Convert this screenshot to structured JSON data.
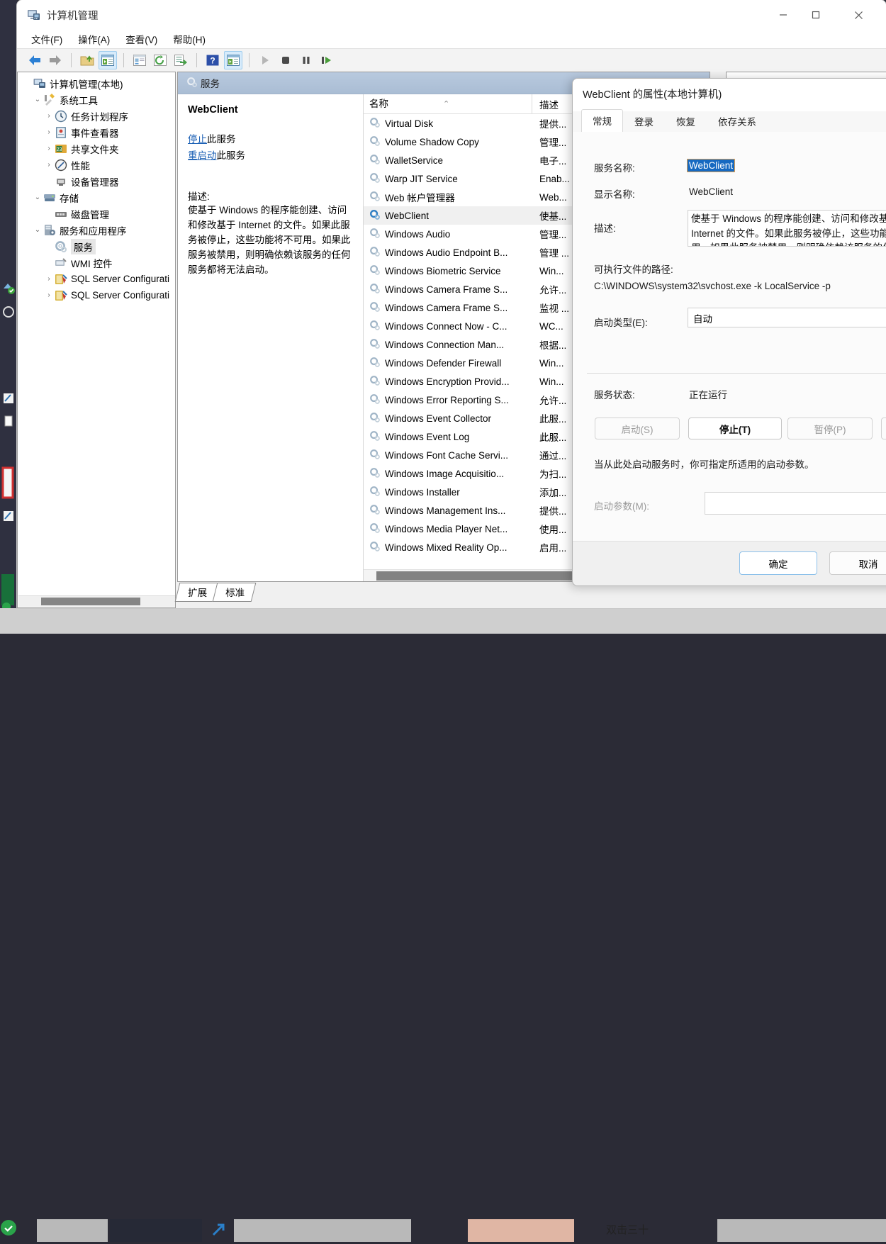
{
  "window": {
    "title": "计算机管理",
    "icon": "computer-management-icon",
    "controls": {
      "minimize": "—",
      "maximize": "□",
      "close": "✕"
    }
  },
  "menubar": [
    {
      "label": "文件(F)",
      "name": "menu-file"
    },
    {
      "label": "操作(A)",
      "name": "menu-action"
    },
    {
      "label": "查看(V)",
      "name": "menu-view"
    },
    {
      "label": "帮助(H)",
      "name": "menu-help"
    }
  ],
  "toolbar": [
    {
      "name": "back-icon",
      "glyph": "⬅",
      "selected": false
    },
    {
      "name": "forward-icon",
      "glyph": "➡",
      "selected": false
    },
    {
      "sep": true
    },
    {
      "name": "up-folder-icon",
      "glyph": "📁",
      "selected": false
    },
    {
      "name": "show-hide-console-tree-icon",
      "glyph": "▤",
      "selected": true
    },
    {
      "sep": true
    },
    {
      "name": "properties-icon",
      "glyph": "▤",
      "selected": false
    },
    {
      "name": "refresh-icon",
      "glyph": "↻",
      "selected": false
    },
    {
      "name": "export-list-icon",
      "glyph": "⇥",
      "selected": false
    },
    {
      "sep": true
    },
    {
      "name": "help-icon",
      "glyph": "?",
      "selected": false
    },
    {
      "name": "show-action-pane-icon",
      "glyph": "▤",
      "selected": true
    },
    {
      "sep": true
    },
    {
      "name": "start-service-icon",
      "glyph": "▶",
      "selected": false
    },
    {
      "name": "stop-service-icon",
      "glyph": "■",
      "selected": false
    },
    {
      "name": "pause-service-icon",
      "glyph": "❙❙",
      "selected": false
    },
    {
      "name": "restart-service-icon",
      "glyph": "❙▶",
      "selected": false
    }
  ],
  "tree": [
    {
      "label": "计算机管理(本地)",
      "indent": 0,
      "chevron": "",
      "icon": "computer-icon",
      "selected": false
    },
    {
      "label": "系统工具",
      "indent": 1,
      "chevron": "⌄",
      "icon": "system-tools-icon",
      "selected": false
    },
    {
      "label": "任务计划程序",
      "indent": 2,
      "chevron": "›",
      "icon": "task-scheduler-icon",
      "selected": false
    },
    {
      "label": "事件查看器",
      "indent": 2,
      "chevron": "›",
      "icon": "event-viewer-icon",
      "selected": false
    },
    {
      "label": "共享文件夹",
      "indent": 2,
      "chevron": "›",
      "icon": "shared-folders-icon",
      "selected": false
    },
    {
      "label": "性能",
      "indent": 2,
      "chevron": "›",
      "icon": "performance-icon",
      "selected": false
    },
    {
      "label": "设备管理器",
      "indent": 2,
      "chevron": "",
      "icon": "device-manager-icon",
      "selected": false
    },
    {
      "label": "存储",
      "indent": 1,
      "chevron": "⌄",
      "icon": "storage-icon",
      "selected": false
    },
    {
      "label": "磁盘管理",
      "indent": 2,
      "chevron": "",
      "icon": "disk-management-icon",
      "selected": false
    },
    {
      "label": "服务和应用程序",
      "indent": 1,
      "chevron": "⌄",
      "icon": "services-apps-icon",
      "selected": false
    },
    {
      "label": "服务",
      "indent": 2,
      "chevron": "",
      "icon": "services-icon",
      "selected": true
    },
    {
      "label": "WMI 控件",
      "indent": 2,
      "chevron": "",
      "icon": "wmi-control-icon",
      "selected": false
    },
    {
      "label": "SQL Server Configurati",
      "indent": 2,
      "chevron": "›",
      "icon": "sql-server-config-icon",
      "selected": false
    },
    {
      "label": "SQL Server Configurati",
      "indent": 2,
      "chevron": "›",
      "icon": "sql-server-config-icon",
      "selected": false
    }
  ],
  "services_view": {
    "header": "服务",
    "header_icon": "services-icon",
    "detail": {
      "title": "WebClient",
      "links": [
        {
          "action": "停止",
          "suffix": "此服务",
          "name": "stop-service-link"
        },
        {
          "action": "重启动",
          "suffix": "此服务",
          "name": "restart-service-link"
        }
      ],
      "description_label": "描述:",
      "description": "使基于 Windows 的程序能创建、访问和修改基于 Internet 的文件。如果此服务被停止，这些功能将不可用。如果此服务被禁用，则明确依赖该服务的任何服务都将无法启动。"
    },
    "columns": {
      "name": "名称",
      "description": "描述",
      "sort_indicator": "⌃"
    },
    "rows": [
      {
        "name": "Virtual Disk",
        "desc": "提供...",
        "selected": false
      },
      {
        "name": "Volume Shadow Copy",
        "desc": "管理...",
        "selected": false
      },
      {
        "name": "WalletService",
        "desc": "电子...",
        "selected": false
      },
      {
        "name": "Warp JIT Service",
        "desc": "Enab...",
        "selected": false
      },
      {
        "name": "Web 帐户管理器",
        "desc": "Web...",
        "selected": false
      },
      {
        "name": "WebClient",
        "desc": "使基...",
        "selected": true
      },
      {
        "name": "Windows Audio",
        "desc": "管理...",
        "selected": false
      },
      {
        "name": "Windows Audio Endpoint B...",
        "desc": "管理 ...",
        "selected": false
      },
      {
        "name": "Windows Biometric Service",
        "desc": "Win...",
        "selected": false
      },
      {
        "name": "Windows Camera Frame S...",
        "desc": "允许...",
        "selected": false
      },
      {
        "name": "Windows Camera Frame S...",
        "desc": "监视 ...",
        "selected": false
      },
      {
        "name": "Windows Connect Now - C...",
        "desc": "WC...",
        "selected": false
      },
      {
        "name": "Windows Connection Man...",
        "desc": "根据...",
        "selected": false
      },
      {
        "name": "Windows Defender Firewall",
        "desc": "Win...",
        "selected": false
      },
      {
        "name": "Windows Encryption Provid...",
        "desc": "Win...",
        "selected": false
      },
      {
        "name": "Windows Error Reporting S...",
        "desc": "允许...",
        "selected": false
      },
      {
        "name": "Windows Event Collector",
        "desc": "此服...",
        "selected": false
      },
      {
        "name": "Windows Event Log",
        "desc": "此服...",
        "selected": false
      },
      {
        "name": "Windows Font Cache Servi...",
        "desc": "通过...",
        "selected": false
      },
      {
        "name": "Windows Image Acquisitio...",
        "desc": "为扫...",
        "selected": false
      },
      {
        "name": "Windows Installer",
        "desc": "添加...",
        "selected": false
      },
      {
        "name": "Windows Management Ins...",
        "desc": "提供...",
        "selected": false
      },
      {
        "name": "Windows Media Player Net...",
        "desc": "使用...",
        "selected": false
      },
      {
        "name": "Windows Mixed Reality Op...",
        "desc": "启用...",
        "selected": false
      }
    ],
    "view_tabs": [
      {
        "label": "扩展",
        "active": true,
        "name": "tab-extended"
      },
      {
        "label": "标准",
        "active": false,
        "name": "tab-standard"
      }
    ]
  },
  "dialog": {
    "title": "WebClient 的属性(本地计算机)",
    "tabs": [
      {
        "label": "常规",
        "active": true,
        "name": "tab-general"
      },
      {
        "label": "登录",
        "active": false,
        "name": "tab-logon"
      },
      {
        "label": "恢复",
        "active": false,
        "name": "tab-recovery"
      },
      {
        "label": "依存关系",
        "active": false,
        "name": "tab-dependencies"
      }
    ],
    "service_name_label": "服务名称:",
    "service_name_value": "WebClient",
    "display_name_label": "显示名称:",
    "display_name_value": "WebClient",
    "description_label": "描述:",
    "description_value": "使基于 Windows 的程序能创建、访问和修改基于 Internet 的文件。如果此服务被停止，这些功能将不可用。如果此服务被禁用，则明确依赖该服务的任何服务都将无法启动。",
    "path_label": "可执行文件的路径:",
    "path_value": "C:\\WINDOWS\\system32\\svchost.exe -k LocalService -p",
    "startup_type_label": "启动类型(E):",
    "startup_type_value": "自动",
    "service_status_label": "服务状态:",
    "service_status_value": "正在运行",
    "buttons": {
      "start": "启动(S)",
      "stop": "停止(T)",
      "pause": "暂停(P)"
    },
    "hint": "当从此处启动服务时，你可指定所适用的启动参数。",
    "param_label": "启动参数(M):",
    "param_value": "",
    "ok": "确定",
    "cancel": "取消"
  },
  "colors": {
    "accent": "#1669c1",
    "link": "#1a5fb4",
    "header_bar": "#b0c2d8",
    "selection": "#f0f0f0"
  }
}
